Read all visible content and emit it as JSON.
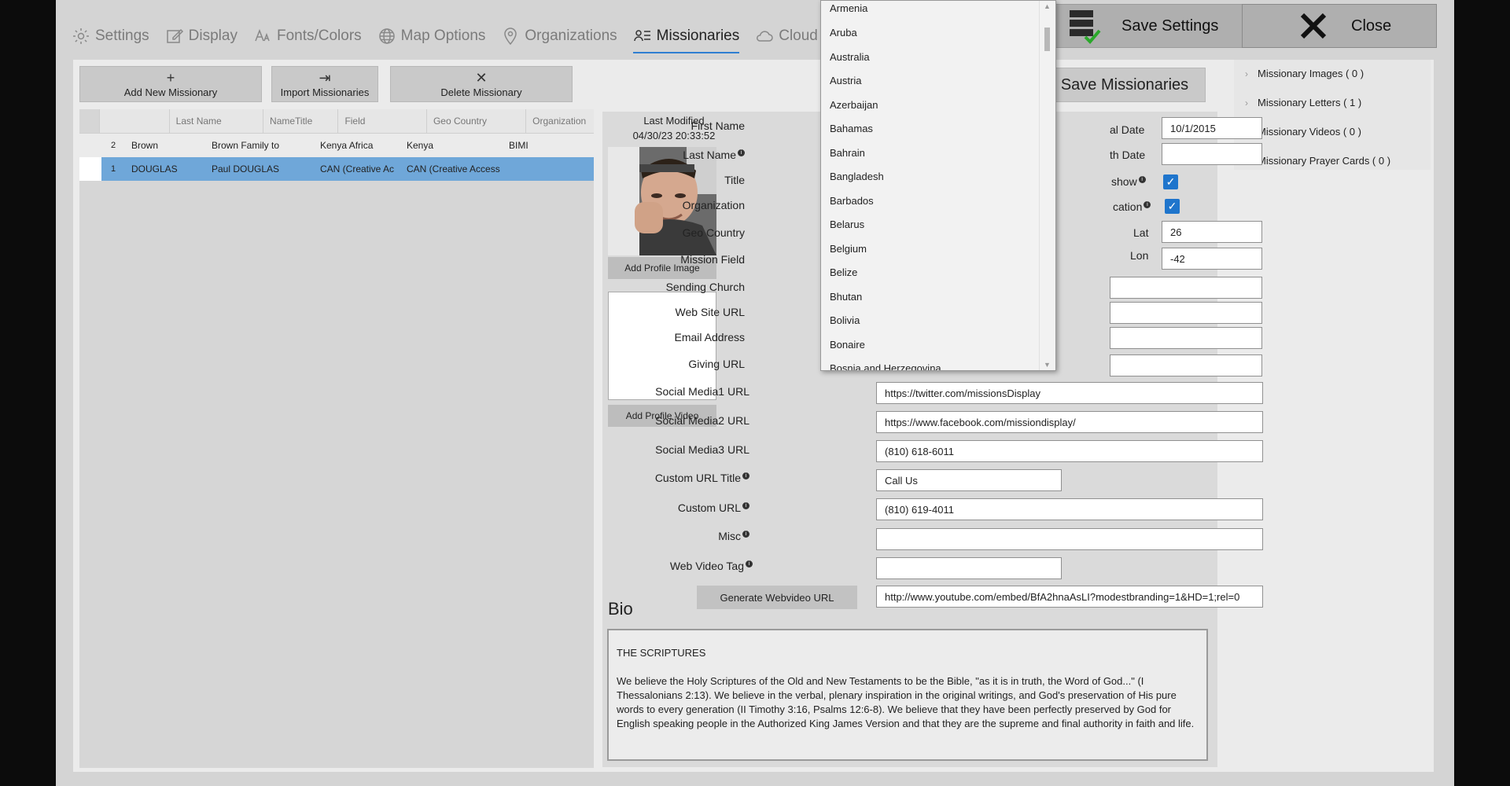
{
  "nav": {
    "tabs": [
      {
        "label": "Settings",
        "icon": "gear-icon"
      },
      {
        "label": "Display",
        "icon": "edit-icon"
      },
      {
        "label": "Fonts/Colors",
        "icon": "font-icon"
      },
      {
        "label": "Map Options",
        "icon": "globe-icon"
      },
      {
        "label": "Organizations",
        "icon": "location-pin-icon"
      },
      {
        "label": "Missionaries",
        "icon": "contact-list-icon"
      },
      {
        "label": "Cloud",
        "icon": "cloud-icon"
      }
    ],
    "active_tab": "Missionaries",
    "save_settings_label": "Save Settings",
    "close_label": "Close"
  },
  "toolbar": {
    "add_label": "Add New Missionary",
    "import_label": "Import Missionaries",
    "delete_label": "Delete Missionary",
    "save_missionaries_label": "Save Missionaries"
  },
  "grid": {
    "columns": [
      "Last Name",
      "NameTitle",
      "Field",
      "Geo Country",
      "Organization"
    ],
    "rows": [
      {
        "num": "2",
        "last_name": "Brown",
        "name_title": "Brown Family to",
        "field": "Kenya Africa",
        "geo_country": "Kenya",
        "organization": "BIMI",
        "selected": false
      },
      {
        "num": "1",
        "last_name": "DOUGLAS",
        "name_title": "Paul  DOUGLAS",
        "field": "CAN (Creative Ac",
        "geo_country": "CAN (Creative Access",
        "organization": "",
        "selected": true
      }
    ]
  },
  "profile": {
    "last_modified_label": "Last Modified",
    "last_modified_value": "04/30/23 20:33:52",
    "add_image_label": "Add Profile Image",
    "add_video_label": "Add Profile Video"
  },
  "form": {
    "labels": {
      "first_name": "First Name",
      "last_name": "Last Name",
      "title": "Title",
      "organization": "Organization",
      "geo_country": "Geo Country",
      "mission_field": "Mission Field",
      "sending_church": "Sending Church",
      "web_site_url": "Web Site URL",
      "email_address": "Email Address",
      "giving_url": "Giving URL",
      "social1": "Social Media1 URL",
      "social2": "Social Media2 URL",
      "social3": "Social Media3 URL",
      "custom_url_title": "Custom URL Title",
      "custom_url": "Custom URL",
      "misc": "Misc",
      "web_video_tag": "Web Video Tag",
      "arrival_date": "al Date",
      "birth_date": "th Date",
      "show": "show",
      "location": "cation",
      "lat": "Lat",
      "lon": "Lon"
    },
    "values": {
      "arrival_date": "10/1/2015",
      "birth_date": "",
      "lat": "26",
      "lon": "-42",
      "social1": "https://twitter.com/missionsDisplay",
      "social2": "https://www.facebook.com/missiondisplay/",
      "social3": "(810) 618-6011",
      "custom_url_title": "Call Us",
      "custom_url": "(810) 619-4011",
      "misc": "",
      "web_video_tag": "",
      "webvideo_url": "http://www.youtube.com/embed/BfA2hnaAsLI?modestbranding=1&HD=1;rel=0"
    },
    "show_checked": true,
    "location_checked": true,
    "generate_btn_label": "Generate Webvideo URL"
  },
  "bio": {
    "label": "Bio",
    "heading": "THE SCRIPTURES",
    "text": "We believe the Holy Scriptures of the Old and New Testaments to be the Bible, \"as it is in truth, the Word of God...\" (I Thessalonians 2:13). We believe in the verbal, plenary inspiration in the original writings, and God's preservation of His pure words to every generation (II Timothy 3:16, Psalms 12:6-8). We believe that they have been perfectly preserved by God for English speaking people in the Authorized King James Version and that they are the supreme and final authority in faith and life."
  },
  "side_panel": {
    "items": [
      "Missionary Images ( 0 )",
      "Missionary Letters ( 1 )",
      "Missionary Videos ( 0 )",
      "Missionary Prayer Cards ( 0 )"
    ]
  },
  "country_dropdown": {
    "items": [
      "Armenia",
      "Aruba",
      "Australia",
      "Austria",
      "Azerbaijan",
      "Bahamas",
      "Bahrain",
      "Bangladesh",
      "Barbados",
      "Belarus",
      "Belgium",
      "Belize",
      "Bhutan",
      "Bolivia",
      "Bonaire",
      "Bosnia and Herzegovina"
    ]
  },
  "colors": {
    "accent": "#1f75cc",
    "selected_row": "#6fa7d9",
    "background": "#d4d4d4"
  }
}
